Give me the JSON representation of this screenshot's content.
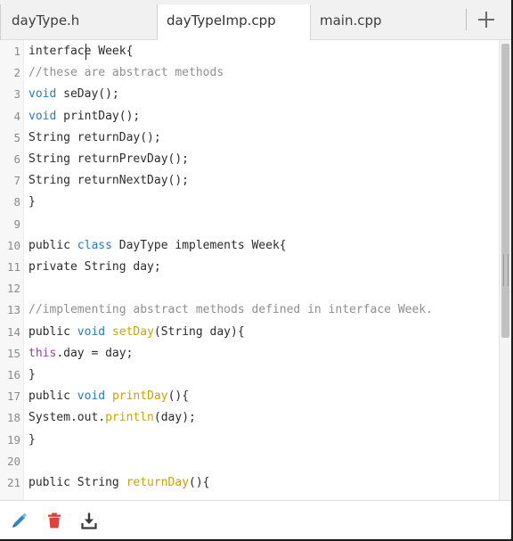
{
  "tabs": [
    {
      "label": "dayType.h",
      "active": false
    },
    {
      "label": "dayTypeImp.cpp",
      "active": true
    },
    {
      "label": "main.cpp",
      "active": false
    }
  ],
  "add_tab_icon": "plus-icon",
  "editor": {
    "lines": [
      {
        "n": "1",
        "segments": [
          {
            "t": "interface Week{",
            "c": "tx"
          }
        ]
      },
      {
        "n": "2",
        "segments": [
          {
            "t": "//these are abstract methods",
            "c": "cm"
          }
        ]
      },
      {
        "n": "3",
        "segments": [
          {
            "t": "void",
            "c": "kw"
          },
          {
            "t": " seDay();",
            "c": "tx"
          }
        ]
      },
      {
        "n": "4",
        "segments": [
          {
            "t": "void",
            "c": "kw"
          },
          {
            "t": " printDay();",
            "c": "tx"
          }
        ]
      },
      {
        "n": "5",
        "segments": [
          {
            "t": "String returnDay();",
            "c": "tx"
          }
        ]
      },
      {
        "n": "6",
        "segments": [
          {
            "t": "String returnPrevDay();",
            "c": "tx"
          }
        ]
      },
      {
        "n": "7",
        "segments": [
          {
            "t": "String returnNextDay();",
            "c": "tx"
          }
        ]
      },
      {
        "n": "8",
        "segments": [
          {
            "t": "}",
            "c": "tx"
          }
        ]
      },
      {
        "n": "9",
        "segments": []
      },
      {
        "n": "10",
        "segments": [
          {
            "t": "public ",
            "c": "tx"
          },
          {
            "t": "class",
            "c": "kw"
          },
          {
            "t": " DayType implements Week{",
            "c": "tx"
          }
        ]
      },
      {
        "n": "11",
        "segments": [
          {
            "t": "private String day;",
            "c": "tx"
          }
        ]
      },
      {
        "n": "12",
        "segments": []
      },
      {
        "n": "13",
        "segments": [
          {
            "t": "//implementing abstract methods defined in interface Week.",
            "c": "cm"
          }
        ]
      },
      {
        "n": "14",
        "segments": [
          {
            "t": "public ",
            "c": "tx"
          },
          {
            "t": "void",
            "c": "kw"
          },
          {
            "t": " ",
            "c": "tx"
          },
          {
            "t": "setDay",
            "c": "fn"
          },
          {
            "t": "(String day){",
            "c": "tx"
          }
        ]
      },
      {
        "n": "15",
        "segments": [
          {
            "t": "this",
            "c": "th"
          },
          {
            "t": ".day = day;",
            "c": "tx"
          }
        ]
      },
      {
        "n": "16",
        "segments": [
          {
            "t": "}",
            "c": "tx"
          }
        ]
      },
      {
        "n": "17",
        "segments": [
          {
            "t": "public ",
            "c": "tx"
          },
          {
            "t": "void",
            "c": "kw"
          },
          {
            "t": " ",
            "c": "tx"
          },
          {
            "t": "printDay",
            "c": "fn"
          },
          {
            "t": "(){",
            "c": "tx"
          }
        ]
      },
      {
        "n": "18",
        "segments": [
          {
            "t": "System.out.",
            "c": "tx"
          },
          {
            "t": "println",
            "c": "fn"
          },
          {
            "t": "(day);",
            "c": "tx"
          }
        ]
      },
      {
        "n": "19",
        "segments": [
          {
            "t": "}",
            "c": "tx"
          }
        ]
      },
      {
        "n": "20",
        "segments": []
      },
      {
        "n": "21",
        "segments": [
          {
            "t": "public String ",
            "c": "tx"
          },
          {
            "t": "returnDay",
            "c": "fn"
          },
          {
            "t": "(){",
            "c": "tx"
          }
        ]
      }
    ]
  },
  "toolbar": {
    "edit_icon": "pencil-icon",
    "delete_icon": "trash-icon",
    "download_icon": "download-icon"
  },
  "colors": {
    "keyword": "#2a7ab8",
    "function": "#c8a400",
    "comment": "#8f8f8f",
    "this_keyword": "#a6369c",
    "edit_icon": "#2f86c9",
    "delete_icon": "#e0413a",
    "download_icon": "#3a3a3a"
  }
}
